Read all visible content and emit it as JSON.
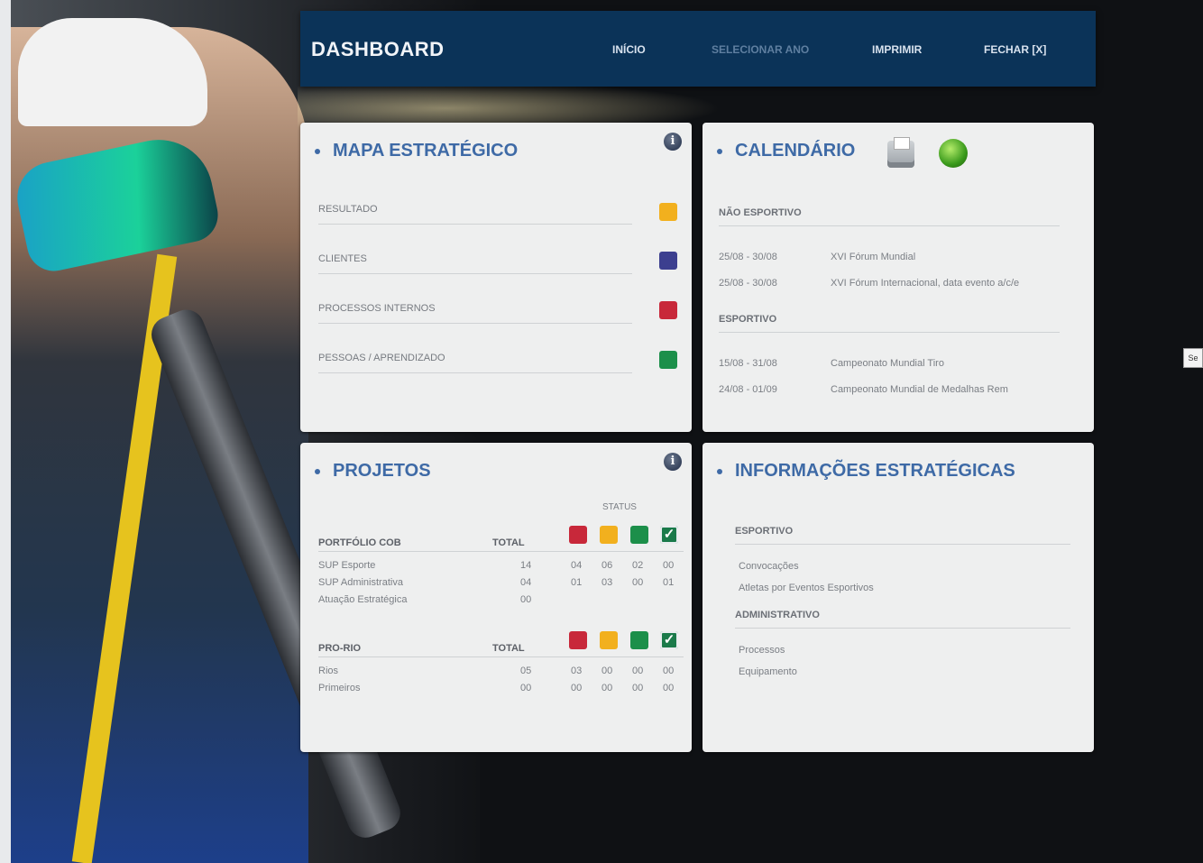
{
  "header": {
    "title": "DASHBOARD",
    "nav": [
      {
        "label": "INÍCIO"
      },
      {
        "label": "SELECIONAR ANO"
      },
      {
        "label": "IMPRIMIR"
      },
      {
        "label": "FECHAR [X]"
      }
    ]
  },
  "mapa": {
    "title": "MAPA ESTRATÉGICO",
    "info_icon": "info-icon",
    "rows": [
      {
        "label": "RESULTADO",
        "color": "#f2b01e"
      },
      {
        "label": "CLIENTES",
        "color": "#3c3f8f"
      },
      {
        "label": "PROCESSOS INTERNOS",
        "color": "#c8283a"
      },
      {
        "label": "PESSOAS / APRENDIZADO",
        "color": "#1c8f4a"
      }
    ]
  },
  "calendario": {
    "title": "CALENDÁRIO",
    "icons": [
      "printer-icon",
      "globe-icon"
    ],
    "sections": [
      {
        "heading": "NÃO ESPORTIVO",
        "events": [
          {
            "date": "25/08 - 30/08",
            "name": "XVI Fórum Mundial"
          },
          {
            "date": "25/08 - 30/08",
            "name": "XVI Fórum Internacional, data evento a/c/e"
          }
        ]
      },
      {
        "heading": "ESPORTIVO",
        "events": [
          {
            "date": "15/08 - 31/08",
            "name": "Campeonato Mundial Tiro"
          },
          {
            "date": "24/08 - 01/09",
            "name": "Campeonato Mundial de Medalhas Rem"
          }
        ]
      }
    ]
  },
  "projetos": {
    "title": "PROJETOS",
    "info_icon": "info-icon",
    "status_label": "STATUS",
    "status_colors": [
      "#c8283a",
      "#f2b01e",
      "#1c8f4a",
      "#1a7a4a"
    ],
    "tables": [
      {
        "heading": "PORTFÓLIO COB",
        "total_label": "TOTAL",
        "rows": [
          {
            "name": "SUP Esporte",
            "total": "14",
            "s": [
              "04",
              "06",
              "02",
              "00"
            ]
          },
          {
            "name": "SUP Administrativa",
            "total": "04",
            "s": [
              "01",
              "03",
              "00",
              "01"
            ]
          },
          {
            "name": "Atuação Estratégica",
            "total": "00",
            "s": [
              "",
              "",
              "",
              ""
            ]
          }
        ]
      },
      {
        "heading": "PRO-RIO",
        "total_label": "TOTAL",
        "rows": [
          {
            "name": "Rios",
            "total": "05",
            "s": [
              "03",
              "00",
              "00",
              "00"
            ]
          },
          {
            "name": "Primeiros",
            "total": "00",
            "s": [
              "00",
              "00",
              "00",
              "00"
            ]
          }
        ]
      }
    ]
  },
  "informacoes": {
    "title": "INFORMAÇÕES ESTRATÉGICAS",
    "groups": [
      {
        "heading": "ESPORTIVO",
        "items": [
          "Convocações",
          "Atletas por Eventos Esportivos"
        ]
      },
      {
        "heading": "ADMINISTRATIVO",
        "items": [
          "Processos",
          "Equipamento"
        ]
      }
    ]
  }
}
